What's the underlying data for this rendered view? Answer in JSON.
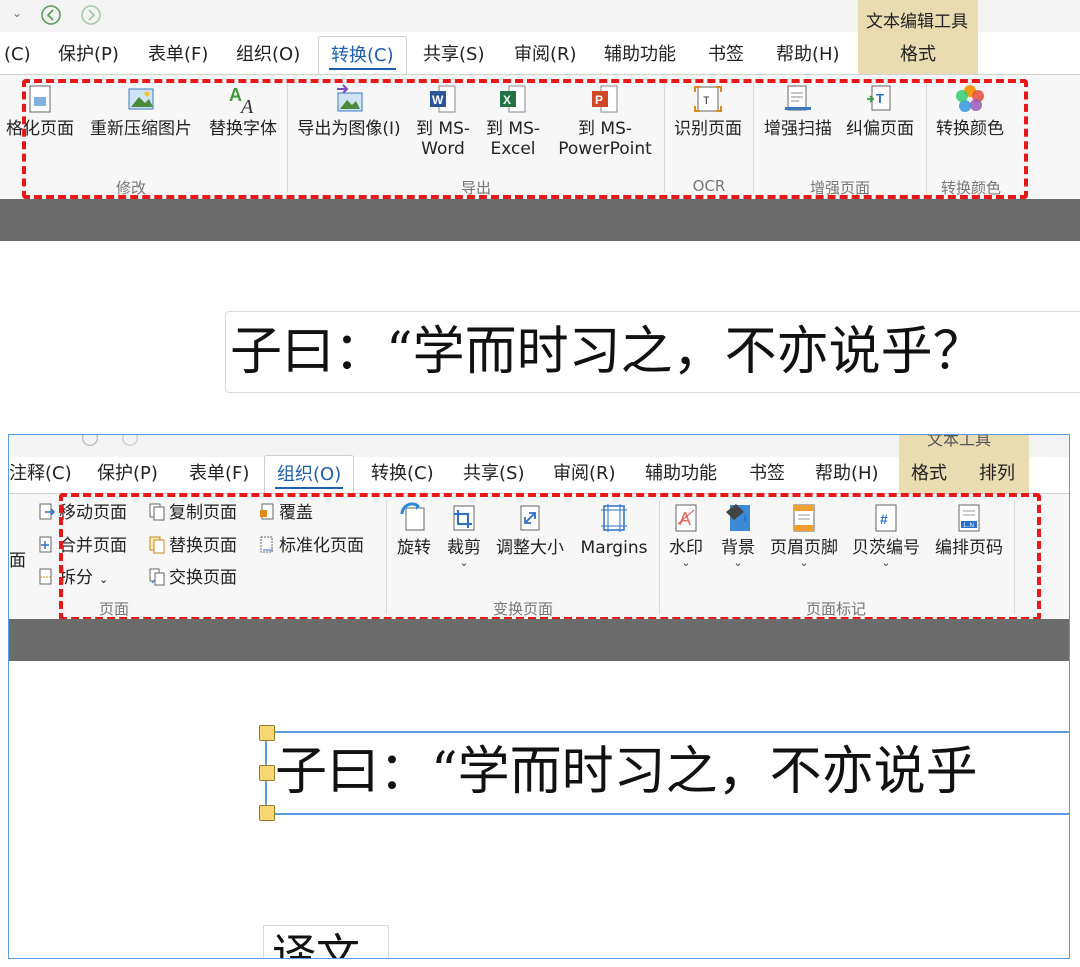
{
  "top": {
    "menu": [
      "(C)",
      "保护(P)",
      "表单(F)",
      "组织(O)",
      "转换(C)",
      "共享(S)",
      "审阅(R)",
      "辅助功能",
      "书签",
      "帮助(H)"
    ],
    "active_menu": "转换(C)",
    "context_group": "文本编辑工具",
    "context_tab": "格式",
    "buttons": {
      "format_page": "格化页面",
      "recompress": "重新压缩图片",
      "replace_font": "替换字体",
      "export_image": "导出为图像(I)",
      "to_word_1": "到 MS-",
      "to_word_2": "Word",
      "to_excel_1": "到 MS-",
      "to_excel_2": "Excel",
      "to_ppt_1": "到 MS-",
      "to_ppt_2": "PowerPoint",
      "recognize": "识别页面",
      "enhance_scan": "增强扫描",
      "deskew": "纠偏页面",
      "convert_color": "转换颜色"
    },
    "groups": [
      "修改",
      "导出",
      "OCR",
      "增强页面",
      "转换颜色"
    ],
    "doc_text": "子曰：“学而时习之，不亦说乎？"
  },
  "bottom": {
    "menu": [
      "注释(C)",
      "保护(P)",
      "表单(F)",
      "组织(O)",
      "转换(C)",
      "共享(S)",
      "审阅(R)",
      "辅助功能",
      "书签",
      "帮助(H)"
    ],
    "active_menu": "组织(O)",
    "context_group": "文本工具",
    "context_tabs": [
      "格式",
      "排列"
    ],
    "left_cut": "面",
    "small_buttons": {
      "move_page": "移动页面",
      "copy_page": "复制页面",
      "cover": "覆盖",
      "merge_page": "合并页面",
      "replace_page": "替换页面",
      "normalize_page": "标准化页面",
      "split": "拆分",
      "swap_page": "交换页面"
    },
    "buttons": {
      "rotate": "旋转",
      "crop": "裁剪",
      "resize": "调整大小",
      "margins": "Margins",
      "watermark": "水印",
      "background": "背景",
      "header_footer": "页眉页脚",
      "bates": "贝茨编号",
      "page_number": "编排页码"
    },
    "groups": [
      "页面",
      "变换页面",
      "页面标记"
    ],
    "doc_text": "子曰：“学而时习之，不亦说乎",
    "doc_text2": "译文"
  },
  "colors": {
    "accent": "#1f5fb0",
    "highlight_dash": "#e81818",
    "context_tab": "#e8dcb0"
  }
}
